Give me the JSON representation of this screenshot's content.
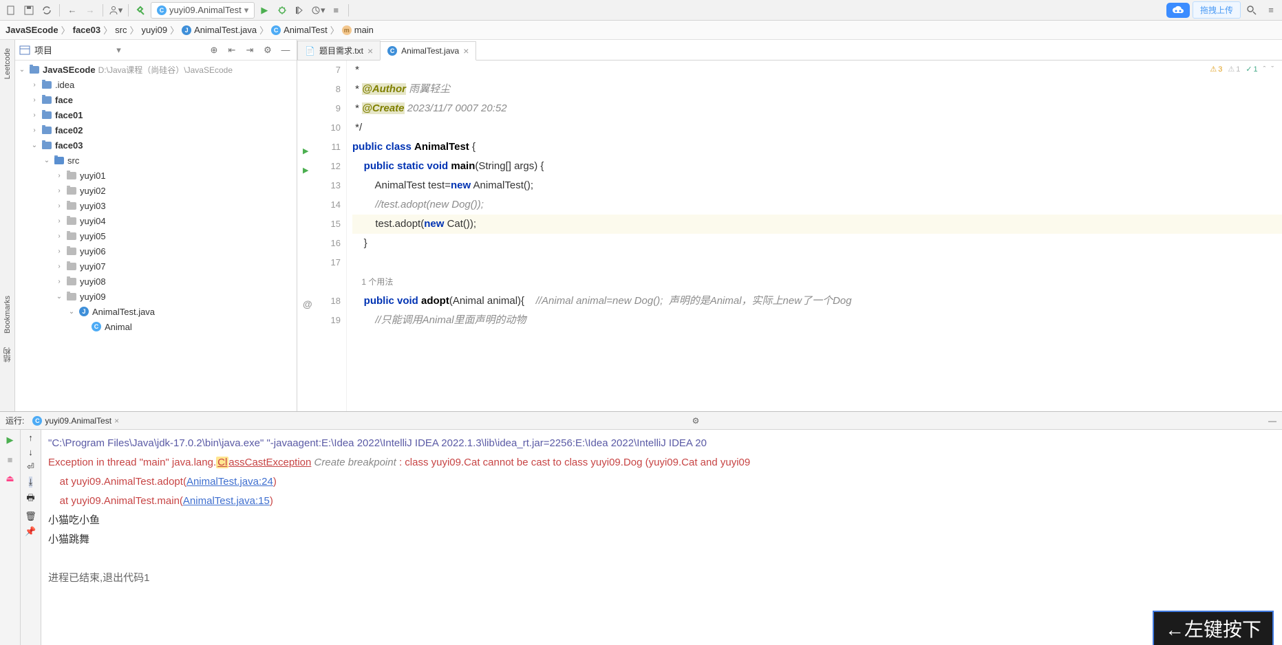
{
  "toolbar": {
    "run_config": "yuyi09.AnimalTest",
    "upload_label": "拖拽上传"
  },
  "breadcrumb": {
    "items": [
      "JavaSEcode",
      "face03",
      "src",
      "yuyi09",
      "AnimalTest.java",
      "AnimalTest",
      "main"
    ]
  },
  "sidebar_tabs": {
    "leetcode": "Leetcode",
    "bookmarks": "Bookmarks",
    "structure": "结构"
  },
  "project": {
    "title": "项目",
    "root": {
      "name": "JavaSEcode",
      "path": "D:\\Java课程（尚硅谷）\\JavaSEcode"
    },
    "tree": [
      {
        "name": ".idea",
        "type": "folder",
        "depth": 1,
        "expand": ">"
      },
      {
        "name": "face",
        "type": "folder",
        "depth": 1,
        "expand": ">",
        "bold": true
      },
      {
        "name": "face01",
        "type": "folder",
        "depth": 1,
        "expand": ">",
        "bold": true
      },
      {
        "name": "face02",
        "type": "folder",
        "depth": 1,
        "expand": ">",
        "bold": true
      },
      {
        "name": "face03",
        "type": "folder",
        "depth": 1,
        "expand": "v",
        "bold": true
      },
      {
        "name": "src",
        "type": "src",
        "depth": 2,
        "expand": "v"
      },
      {
        "name": "yuyi01",
        "type": "package",
        "depth": 3,
        "expand": ">"
      },
      {
        "name": "yuyi02",
        "type": "package",
        "depth": 3,
        "expand": ">"
      },
      {
        "name": "yuyi03",
        "type": "package",
        "depth": 3,
        "expand": ">"
      },
      {
        "name": "yuyi04",
        "type": "package",
        "depth": 3,
        "expand": ">"
      },
      {
        "name": "yuyi05",
        "type": "package",
        "depth": 3,
        "expand": ">"
      },
      {
        "name": "yuyi06",
        "type": "package",
        "depth": 3,
        "expand": ">"
      },
      {
        "name": "yuyi07",
        "type": "package",
        "depth": 3,
        "expand": ">"
      },
      {
        "name": "yuyi08",
        "type": "package",
        "depth": 3,
        "expand": ">"
      },
      {
        "name": "yuyi09",
        "type": "package",
        "depth": 3,
        "expand": "v"
      },
      {
        "name": "AnimalTest.java",
        "type": "java",
        "depth": 4,
        "expand": "v"
      },
      {
        "name": "Animal",
        "type": "class",
        "depth": 5,
        "expand": ""
      }
    ]
  },
  "tabs": [
    {
      "label": "题目需求.txt",
      "icon": "txt",
      "active": false
    },
    {
      "label": "AnimalTest.java",
      "icon": "java",
      "active": true
    }
  ],
  "editor": {
    "lines": [
      {
        "num": "7",
        "html": " *"
      },
      {
        "num": "8",
        "html": " * <span class='ann'>@Author</span> <span class='cm'>雨翼轻尘</span>"
      },
      {
        "num": "9",
        "html": " * <span class='ann'>@Create</span> <span class='cm'>2023/11/7 0007 20:52</span>"
      },
      {
        "num": "10",
        "html": " */"
      },
      {
        "num": "11",
        "html": "<span class='kw'>public class</span> <span class='nm'>AnimalTest</span> {",
        "gutter": "run"
      },
      {
        "num": "12",
        "html": "    <span class='kw'>public static void</span> <span class='nm'>main</span>(String[] args) {",
        "gutter": "run"
      },
      {
        "num": "13",
        "html": "        AnimalTest test=<span class='kw'>new</span> AnimalTest();"
      },
      {
        "num": "14",
        "html": "        <span class='cm'>//test.adopt(new Dog());</span>"
      },
      {
        "num": "15",
        "html": "        test.adopt(<span class='kw'>new</span> Cat());",
        "hl": true
      },
      {
        "num": "16",
        "html": "    }"
      },
      {
        "num": "17",
        "html": ""
      },
      {
        "num": "",
        "html": "",
        "usage": "1 个用法"
      },
      {
        "num": "18",
        "html": "    <span class='kw'>public void</span> <span class='nm'>adopt</span>(Animal animal){    <span class='cm'>//Animal animal=new Dog();  声明的是Animal，实际上new了一个Dog</span>",
        "gutter": "at"
      },
      {
        "num": "19",
        "html": "        <span class='cm'>//只能调用Animal里面声明的动物</span>"
      }
    ],
    "inspections": {
      "warnings": "3",
      "weak": "1",
      "typo": "1"
    }
  },
  "run": {
    "label": "运行:",
    "tab_name": "yuyi09.AnimalTest",
    "console": {
      "cmd": "\"C:\\Program Files\\Java\\jdk-17.0.2\\bin\\java.exe\" \"-javaagent:E:\\Idea 2022\\IntelliJ IDEA 2022.1.3\\lib\\idea_rt.jar=2256:E:\\Idea 2022\\IntelliJ IDEA 20",
      "exc": "Exception in thread \"main\" java.lang.",
      "exc_hl": "Cl",
      "exc_rest": "assCastException",
      "create_bp": "Create breakpoint",
      "exc_msg": ": class yuyi09.Cat cannot be cast to class yuyi09.Dog (yuyi09.Cat and yuyi09",
      "at1_pre": "    at yuyi09.AnimalTest.adopt(",
      "at1_link": "AnimalTest.java:24",
      "at1_post": ")",
      "at2_pre": "    at yuyi09.AnimalTest.main(",
      "at2_link": "AnimalTest.java:15",
      "at2_post": ")",
      "out1": "小猫吃小鱼",
      "out2": "小猫跳舞",
      "exit": "进程已结束,退出代码1"
    }
  },
  "overlay": "←左键按下"
}
